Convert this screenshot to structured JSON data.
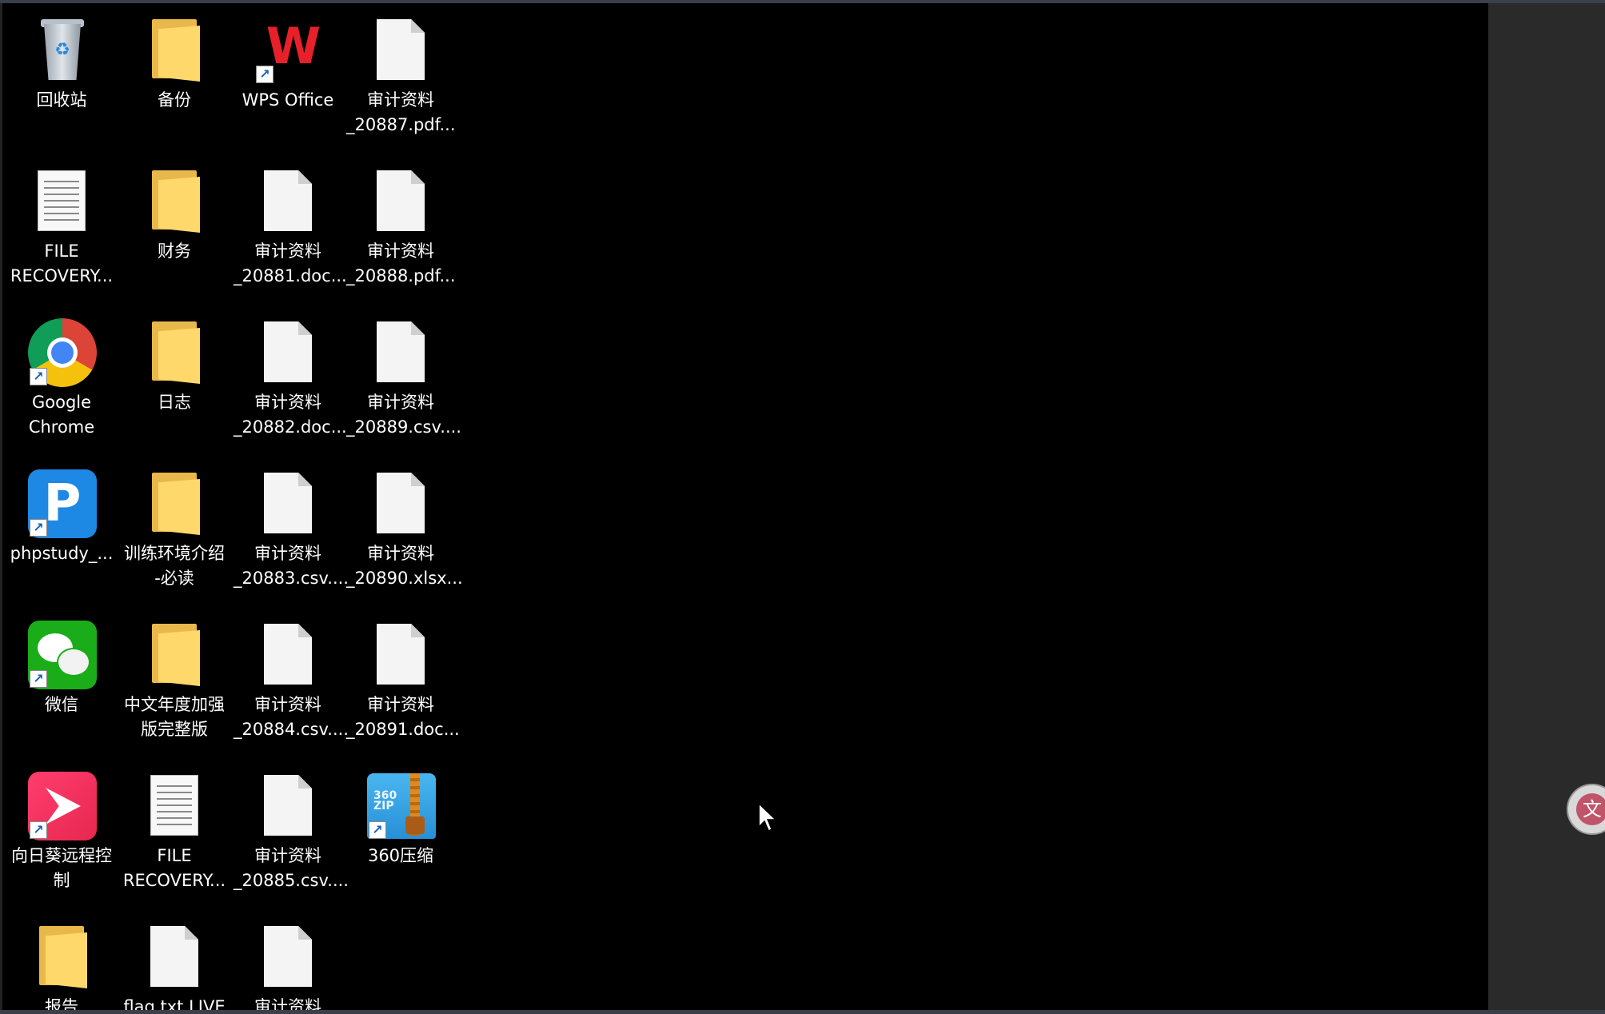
{
  "desktop": {
    "icons": [
      {
        "id": "recycle-bin",
        "lines": [
          "回收站"
        ],
        "icon": "recycle-bin-icon"
      },
      {
        "id": "backup-folder",
        "lines": [
          "备份"
        ],
        "icon": "folder-icon"
      },
      {
        "id": "wps-office",
        "lines": [
          "WPS Office"
        ],
        "icon": "wps-office-icon"
      },
      {
        "id": "audit-20887",
        "lines": [
          "审计资料",
          "_20887.pdf..."
        ],
        "icon": "file-icon"
      },
      {
        "id": "file-recovery-1",
        "lines": [
          "FILE",
          "RECOVERY..."
        ],
        "icon": "text-file-icon"
      },
      {
        "id": "finance-folder",
        "lines": [
          "财务"
        ],
        "icon": "folder-icon"
      },
      {
        "id": "audit-20881",
        "lines": [
          "审计资料",
          "_20881.doc..."
        ],
        "icon": "file-icon"
      },
      {
        "id": "audit-20888",
        "lines": [
          "审计资料",
          "_20888.pdf..."
        ],
        "icon": "file-icon"
      },
      {
        "id": "google-chrome",
        "lines": [
          "Google",
          "Chrome"
        ],
        "icon": "chrome-icon"
      },
      {
        "id": "log-folder",
        "lines": [
          "日志"
        ],
        "icon": "folder-icon"
      },
      {
        "id": "audit-20882",
        "lines": [
          "审计资料",
          "_20882.doc..."
        ],
        "icon": "file-icon"
      },
      {
        "id": "audit-20889",
        "lines": [
          "审计资料",
          "_20889.csv...."
        ],
        "icon": "file-icon"
      },
      {
        "id": "phpstudy",
        "lines": [
          "phpstudy_..."
        ],
        "icon": "phpstudy-icon"
      },
      {
        "id": "training-intro-folder",
        "lines": [
          "训练环境介绍",
          "-必读"
        ],
        "icon": "folder-icon"
      },
      {
        "id": "audit-20883",
        "lines": [
          "审计资料",
          "_20883.csv...."
        ],
        "icon": "file-icon"
      },
      {
        "id": "audit-20890",
        "lines": [
          "审计资料",
          "_20890.xlsx..."
        ],
        "icon": "file-icon"
      },
      {
        "id": "wechat",
        "lines": [
          "微信"
        ],
        "icon": "wechat-icon"
      },
      {
        "id": "annual-enhanced-folder",
        "lines": [
          "中文年度加强",
          "版完整版"
        ],
        "icon": "folder-icon"
      },
      {
        "id": "audit-20884",
        "lines": [
          "审计资料",
          "_20884.csv...."
        ],
        "icon": "file-icon"
      },
      {
        "id": "audit-20891",
        "lines": [
          "审计资料",
          "_20891.doc..."
        ],
        "icon": "file-icon"
      },
      {
        "id": "sunlogin",
        "lines": [
          "向日葵远程控",
          "制"
        ],
        "icon": "sunlogin-icon"
      },
      {
        "id": "file-recovery-2",
        "lines": [
          "FILE",
          "RECOVERY..."
        ],
        "icon": "text-file-icon"
      },
      {
        "id": "audit-20885",
        "lines": [
          "审计资料",
          "_20885.csv...."
        ],
        "icon": "file-icon"
      },
      {
        "id": "360zip",
        "lines": [
          "360压缩"
        ],
        "icon": "360zip-icon"
      },
      {
        "id": "report-folder",
        "lines": [
          "报告"
        ],
        "icon": "folder-icon"
      },
      {
        "id": "flag-file",
        "lines": [
          "flag.txt.LIVE"
        ],
        "icon": "file-icon"
      },
      {
        "id": "audit-partial",
        "lines": [
          "审计资料"
        ],
        "icon": "file-icon"
      }
    ],
    "zip_badge": [
      "360",
      "ZIP"
    ],
    "phpstudy_letter": "P",
    "assist_button_glyph": "文"
  },
  "colors": {
    "desktop_background": "#000000",
    "folder_yellow": "#ffd86b",
    "wps_red": "#e8202a",
    "wechat_green": "#1aad19",
    "phpstudy_blue": "#1e88e5",
    "sunlogin_pink": "#ff3d6e"
  }
}
